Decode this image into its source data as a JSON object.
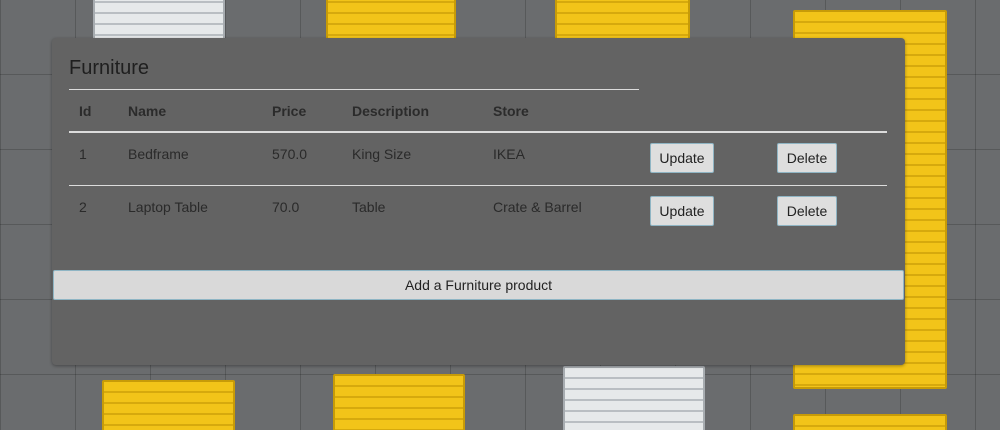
{
  "panel": {
    "title": "Furniture"
  },
  "table": {
    "headers": [
      "Id",
      "Name",
      "Price",
      "Description",
      "Store"
    ],
    "rows": [
      {
        "id": "1",
        "name": "Bedframe",
        "price": "570.0",
        "description": "King Size",
        "store": "IKEA",
        "update_label": "Update",
        "delete_label": "Delete"
      },
      {
        "id": "2",
        "name": "Laptop Table",
        "price": "70.0",
        "description": "Table",
        "store": "Crate & Barrel",
        "update_label": "Update",
        "delete_label": "Delete"
      }
    ]
  },
  "actions": {
    "add_label": "Add a Furniture product"
  },
  "colors": {
    "panel": "#636363",
    "button": "#dedede",
    "button_border": "#8fb5c4",
    "container_yellow": "#f2c419",
    "container_white": "#e6e9ea"
  }
}
